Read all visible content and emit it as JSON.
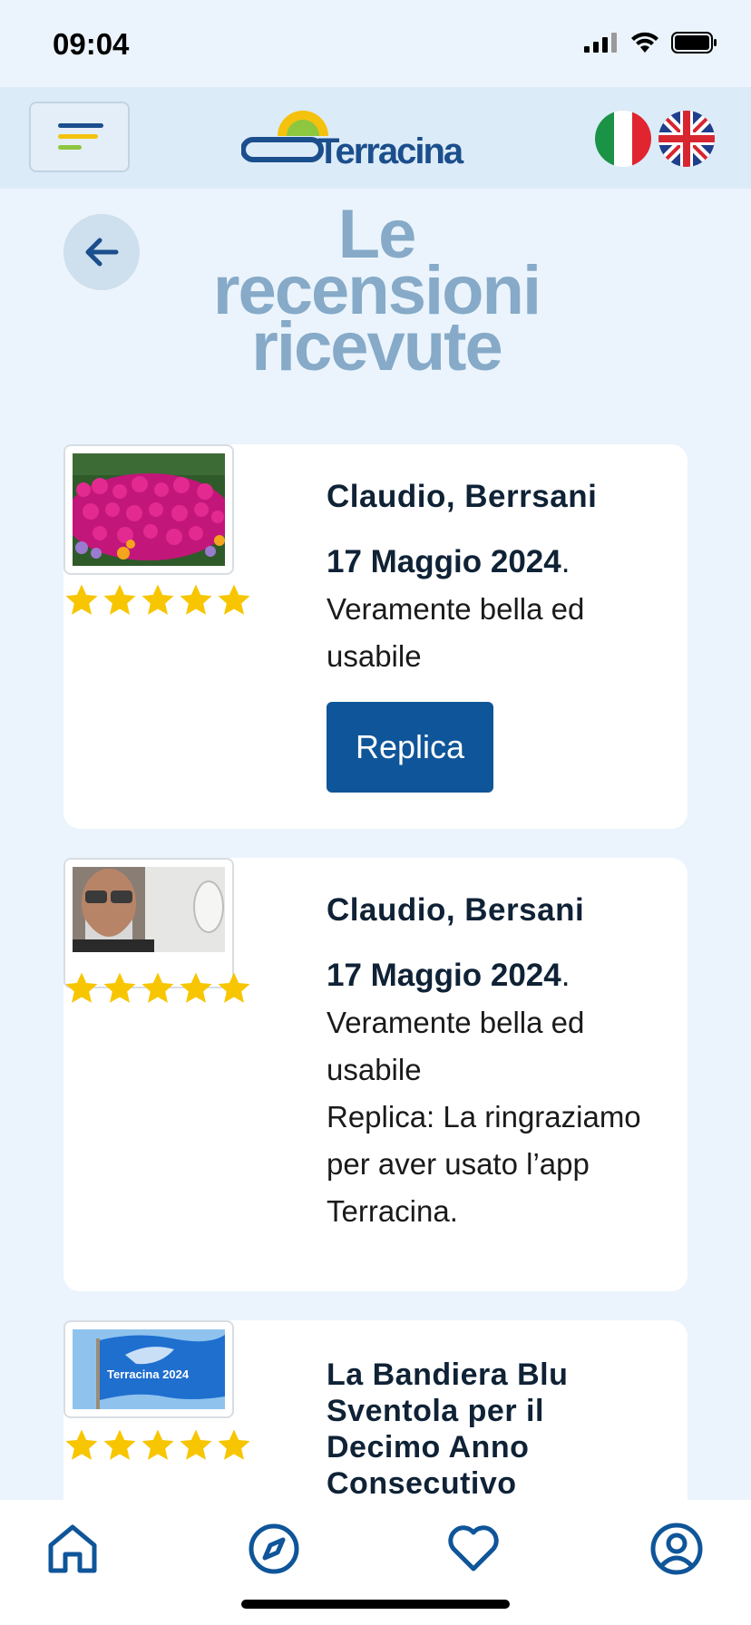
{
  "status_bar": {
    "time": "09:04"
  },
  "header": {
    "logo_text": "Terracina",
    "colors": {
      "header_bg": "#dcebf8",
      "logo_blue": "#1b4e8c",
      "logo_yellow": "#f4c20d"
    }
  },
  "page": {
    "title": "Le recensioni ricevute"
  },
  "reviews": [
    {
      "name": "Claudio, Berrsani",
      "date": "17 Maggio 2024",
      "date_suffix": ".",
      "text": "Veramente bella ed usabile",
      "reply_button": "Replica",
      "rating": 5,
      "image": "pink-flowers-photo"
    },
    {
      "name": "Claudio, Bersani",
      "date": "17 Maggio 2024",
      "date_suffix": ".",
      "text": "Veramente bella ed usabile",
      "reply_text": "Replica: La ringraziamo per aver usato l’app Terracina.",
      "rating": 5,
      "image": "man-selfie-photo"
    },
    {
      "title": "La Bandiera Blu Sventola per il Decimo Anno Consecutivo",
      "rating": 5,
      "image_caption": "Terracina 2024",
      "image": "blue-flag-photo"
    }
  ],
  "bottom_nav": {
    "items": [
      "home-icon",
      "compass-icon",
      "heart-icon",
      "profile-icon"
    ],
    "color": "#0f5599"
  }
}
